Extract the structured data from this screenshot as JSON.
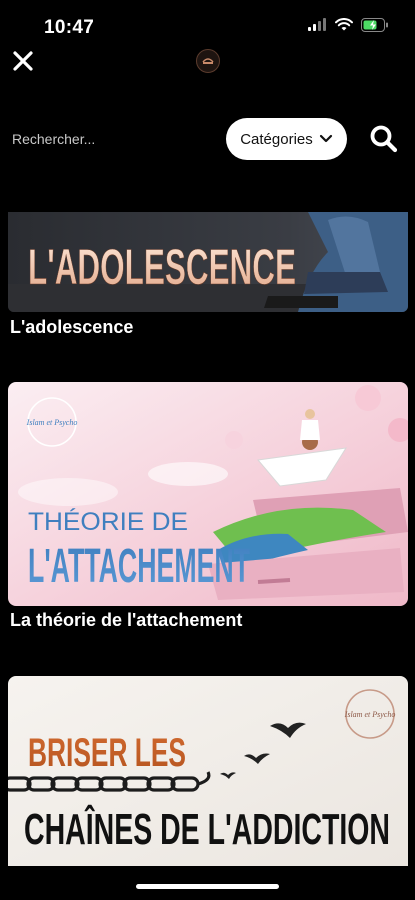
{
  "status_bar": {
    "time": "10:47"
  },
  "header": {
    "close_icon": "close-icon",
    "logo_icon": "app-logo-icon"
  },
  "search": {
    "placeholder": "Rechercher...",
    "value": "",
    "categories_label": "Catégories",
    "search_icon": "search-icon"
  },
  "items": [
    {
      "image_text": "L'ADOLESCENCE",
      "title": "L'adolescence"
    },
    {
      "image_text_1": "THÉORIE DE",
      "image_text_2": "L'ATTACHEMENT",
      "logo_text": "Islam et Psycho",
      "title": "La théorie de l'attachement"
    },
    {
      "image_text_1": "BRISER LES",
      "image_text_2": "CHAÎNES DE L'ADDICTION",
      "logo_text": "Islam et Psycho"
    }
  ]
}
